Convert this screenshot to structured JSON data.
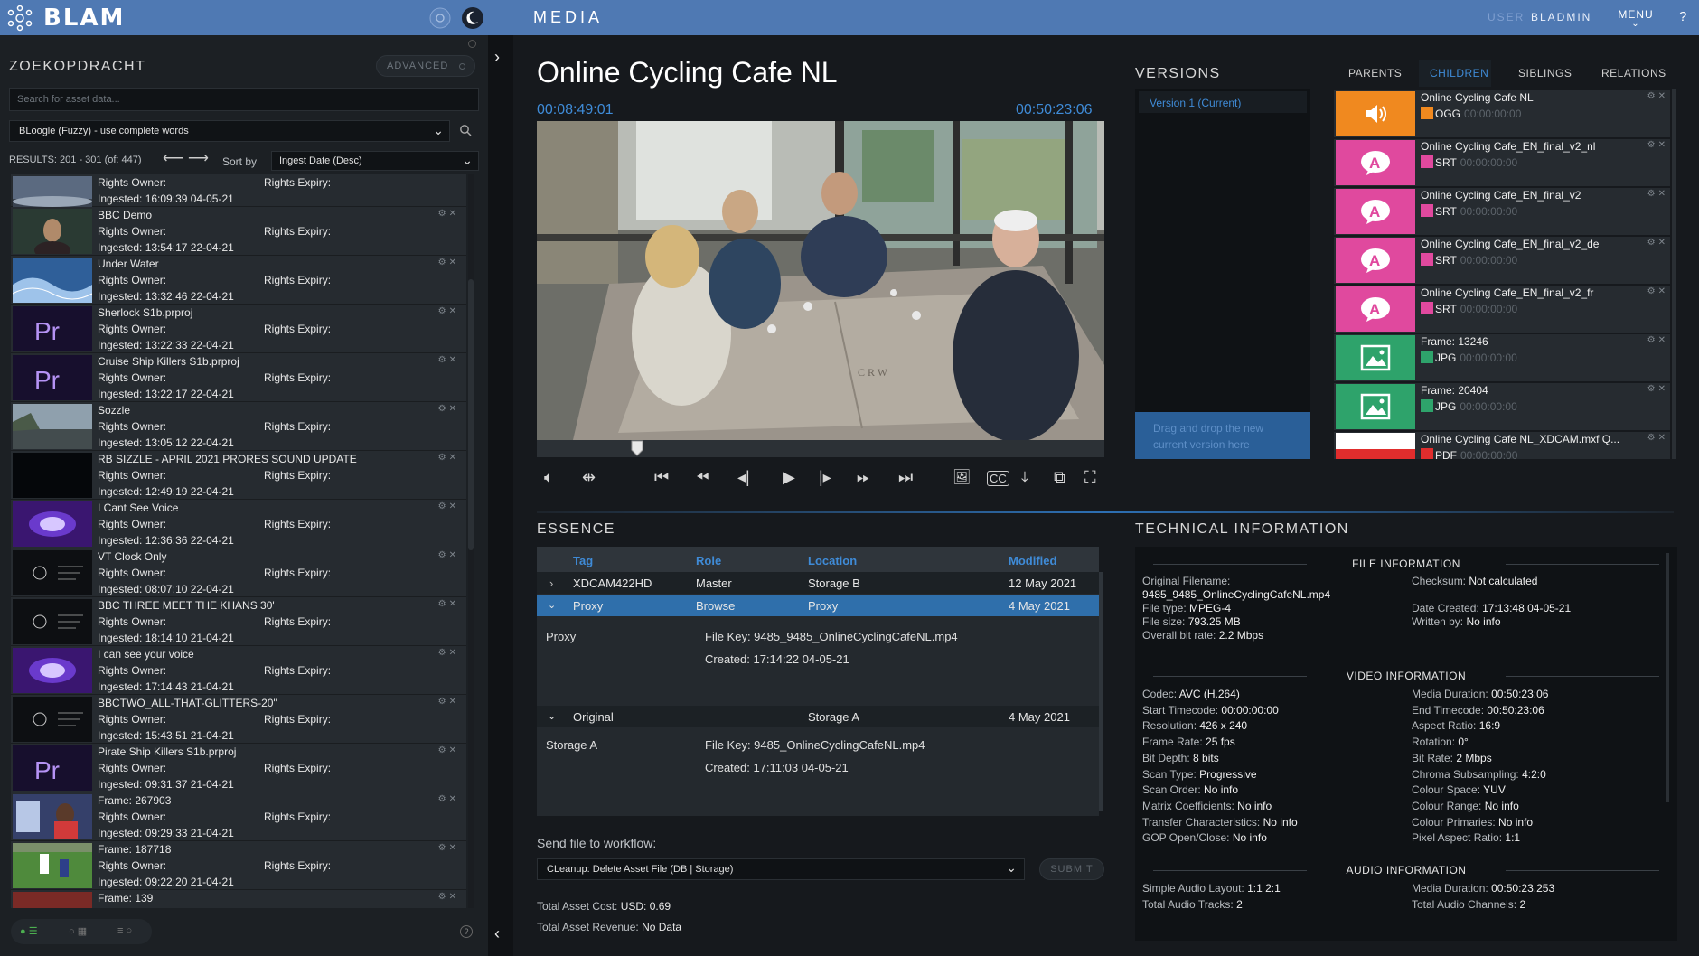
{
  "topbar": {
    "logo": "BLAM",
    "section": "MEDIA",
    "user_label": "USER",
    "user_name": "BLADMIN",
    "menu": "MENU",
    "help": "?"
  },
  "search": {
    "title": "ZOEKOPDRACHT",
    "advanced": "ADVANCED",
    "placeholder": "Search for asset data...",
    "engine": "BLoogle (Fuzzy) - use complete words",
    "results": "RESULTS: 201 - 301 (of: 447)",
    "sort_label": "Sort by",
    "sort_value": "Ingest Date (Desc)"
  },
  "asset_labels": {
    "owner": "Rights Owner:",
    "expiry": "Rights Expiry:"
  },
  "assets": [
    {
      "title": "",
      "ingested": "Ingested: 16:09:39 04-05-21",
      "thumb": "sky"
    },
    {
      "title": "BBC Demo",
      "ingested": "Ingested: 13:54:17 22-04-21",
      "thumb": "person"
    },
    {
      "title": "Under Water",
      "ingested": "Ingested: 13:32:46 22-04-21",
      "thumb": "water"
    },
    {
      "title": "Sherlock S1b.prproj",
      "ingested": "Ingested: 13:22:33 22-04-21",
      "thumb": "pr"
    },
    {
      "title": "Cruise Ship Killers S1b.prproj",
      "ingested": "Ingested: 13:22:17 22-04-21",
      "thumb": "pr"
    },
    {
      "title": "Sozzle",
      "ingested": "Ingested: 13:05:12 22-04-21",
      "thumb": "coast"
    },
    {
      "title": "RB SIZZLE - APRIL 2021 PRORES SOUND UPDATE",
      "ingested": "Ingested: 12:49:19 22-04-21",
      "thumb": "black"
    },
    {
      "title": "I Cant See Voice",
      "ingested": "Ingested: 12:36:36 22-04-21",
      "thumb": "voice"
    },
    {
      "title": "VT Clock Only",
      "ingested": "Ingested: 08:07:10 22-04-21",
      "thumb": "clock"
    },
    {
      "title": "BBC THREE MEET THE KHANS 30'",
      "ingested": "Ingested: 18:14:10 21-04-21",
      "thumb": "clock"
    },
    {
      "title": "I can see your voice",
      "ingested": "Ingested: 17:14:43 21-04-21",
      "thumb": "voice"
    },
    {
      "title": "BBCTWO_ALL-THAT-GLITTERS-20\"",
      "ingested": "Ingested: 15:43:51 21-04-21",
      "thumb": "clock"
    },
    {
      "title": "Pirate Ship Killers S1b.prproj",
      "ingested": "Ingested: 09:31:37 21-04-21",
      "thumb": "pr"
    },
    {
      "title": "Frame: 267903",
      "ingested": "Ingested: 09:29:33 21-04-21",
      "thumb": "football"
    },
    {
      "title": "Frame: 187718",
      "ingested": "Ingested: 09:22:20 21-04-21",
      "thumb": "pitch"
    },
    {
      "title": "Frame: 139",
      "ingested": "",
      "thumb": "crowd"
    }
  ],
  "player": {
    "title": "Online Cycling Cafe NL",
    "tc_current": "00:08:49:01",
    "tc_duration": "00:50:23:06",
    "table_logo": "C R W"
  },
  "versions": {
    "title": "VERSIONS",
    "current": "Version 1 (Current)",
    "drop_line1": "Drag and drop the new",
    "drop_line2": "current version here"
  },
  "relation_tabs": [
    "PARENTS",
    "CHILDREN",
    "SIBLINGS",
    "RELATIONS"
  ],
  "related": [
    {
      "title": "Online Cycling Cafe NL",
      "type": "OGG",
      "tc": "00:00:00:00",
      "kind": "audio"
    },
    {
      "title": "Online Cycling Cafe_EN_final_v2_nl",
      "type": "SRT",
      "tc": "00:00:00:00",
      "kind": "subtitle"
    },
    {
      "title": "Online Cycling Cafe_EN_final_v2",
      "type": "SRT",
      "tc": "00:00:00:00",
      "kind": "subtitle"
    },
    {
      "title": "Online Cycling Cafe_EN_final_v2_de",
      "type": "SRT",
      "tc": "00:00:00:00",
      "kind": "subtitle"
    },
    {
      "title": "Online Cycling Cafe_EN_final_v2_fr",
      "type": "SRT",
      "tc": "00:00:00:00",
      "kind": "subtitle"
    },
    {
      "title": "Frame: 13246",
      "type": "JPG",
      "tc": "00:00:00:00",
      "kind": "image"
    },
    {
      "title": "Frame: 20404",
      "type": "JPG",
      "tc": "00:00:00:00",
      "kind": "image"
    },
    {
      "title": "Online Cycling Cafe NL_XDCAM.mxf Q...",
      "type": "PDF",
      "tc": "00:00:00:00",
      "kind": "pdf"
    }
  ],
  "pdf_label": "PDF",
  "essence": {
    "title": "ESSENCE",
    "columns": [
      "Tag",
      "Role",
      "Location",
      "Modified"
    ],
    "rows": [
      {
        "tag": "XDCAM422HD",
        "role": "Master",
        "location": "Storage B",
        "modified": "12 May 2021"
      },
      {
        "tag": "Proxy",
        "role": "Browse",
        "location": "Proxy",
        "modified": "4 May 2021"
      }
    ],
    "proxy_detail": {
      "name": "Proxy",
      "file_key": "File Key: 9485_9485_OnlineCyclingCafeNL.mp4",
      "created": "Created: 17:14:22 04-05-21"
    },
    "original_row": {
      "tag": "Original",
      "location": "Storage A",
      "modified": "4 May 2021"
    },
    "original_detail": {
      "name": "Storage A",
      "file_key": "File Key: 9485_OnlineCyclingCafeNL.mp4",
      "created": "Created: 17:11:03 04-05-21"
    }
  },
  "workflow": {
    "label": "Send file to workflow:",
    "selected": "CLeanup: Delete Asset File (DB | Storage)",
    "submit": "SUBMIT",
    "cost_label": "Total Asset Cost:",
    "cost_value": "USD: 0.69",
    "revenue_label": "Total Asset Revenue:",
    "revenue_value": "No Data"
  },
  "tech": {
    "title": "TECHNICAL INFORMATION",
    "file_section": "FILE INFORMATION",
    "video_section": "VIDEO INFORMATION",
    "audio_section": "AUDIO INFORMATION",
    "file_left": [
      {
        "k": "Original Filename:",
        "v": ""
      },
      {
        "k": "",
        "v": "9485_9485_OnlineCyclingCafeNL.mp4"
      },
      {
        "k": "File type:",
        "v": "MPEG-4"
      },
      {
        "k": "File size:",
        "v": "793.25 MB"
      },
      {
        "k": "Overall bit rate:",
        "v": "2.2 Mbps"
      }
    ],
    "file_right": [
      {
        "k": "Checksum:",
        "v": "Not calculated"
      },
      {
        "k": "",
        "v": ""
      },
      {
        "k": "Date Created:",
        "v": "17:13:48 04-05-21"
      },
      {
        "k": "Written by:",
        "v": "No info"
      }
    ],
    "video_left": [
      {
        "k": "Codec:",
        "v": "AVC (H.264)"
      },
      {
        "k": "Start Timecode:",
        "v": "00:00:00:00"
      },
      {
        "k": "Resolution:",
        "v": "426 x 240"
      },
      {
        "k": "Frame Rate:",
        "v": "25 fps"
      },
      {
        "k": "Bit Depth:",
        "v": "8 bits"
      },
      {
        "k": "Scan Type:",
        "v": "Progressive"
      },
      {
        "k": "Scan Order:",
        "v": "No info"
      },
      {
        "k": "Matrix Coefficients:",
        "v": "No info"
      },
      {
        "k": "Transfer Characteristics:",
        "v": "No info"
      },
      {
        "k": "GOP Open/Close:",
        "v": "No info"
      }
    ],
    "video_right": [
      {
        "k": "Media Duration:",
        "v": "00:50:23:06"
      },
      {
        "k": "End Timecode:",
        "v": "00:50:23:06"
      },
      {
        "k": "Aspect Ratio:",
        "v": "16:9"
      },
      {
        "k": "Rotation:",
        "v": "0°"
      },
      {
        "k": "Bit Rate:",
        "v": "2 Mbps"
      },
      {
        "k": "Chroma Subsampling:",
        "v": "4:2:0"
      },
      {
        "k": "Colour Space:",
        "v": "YUV"
      },
      {
        "k": "Colour Range:",
        "v": "No info"
      },
      {
        "k": "Colour Primaries:",
        "v": "No info"
      },
      {
        "k": "Pixel Aspect Ratio:",
        "v": "1:1"
      }
    ],
    "audio_left": [
      {
        "k": "Simple Audio Layout:",
        "v": "1:1 2:1"
      },
      {
        "k": "Total Audio Tracks:",
        "v": "2"
      }
    ],
    "audio_right": [
      {
        "k": "Media Duration:",
        "v": "00:50:23.253"
      },
      {
        "k": "Total Audio Channels:",
        "v": "2"
      }
    ]
  },
  "colors": {
    "topbar": "#4f79b3",
    "accent": "#3f8bd7",
    "subtitle_pink": "#e0499e",
    "image_green": "#2ea36b",
    "audio_orange": "#f0891f",
    "pdf_red": "#e02d2d"
  }
}
